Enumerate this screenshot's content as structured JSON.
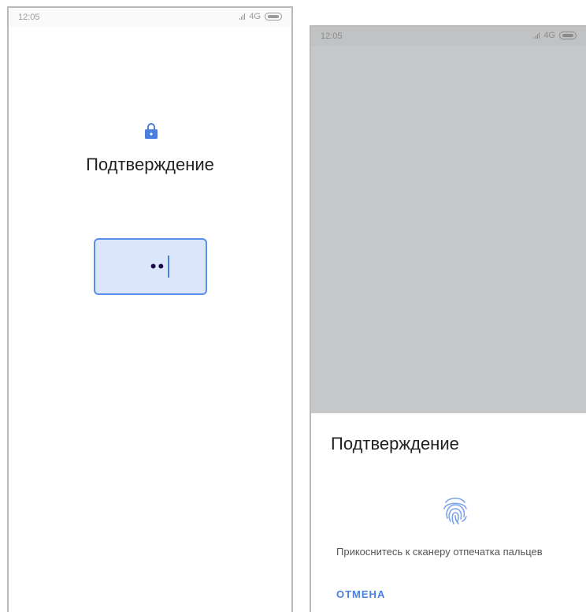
{
  "left_screen": {
    "status": {
      "time": "12:05",
      "network": "4G"
    },
    "title": "Подтверждение",
    "pin_field": {
      "masked_value": "••"
    }
  },
  "right_screen": {
    "status": {
      "time": "12:05",
      "network": "4G"
    },
    "dialog": {
      "title": "Подтверждение",
      "hint": "Прикоснитесь к сканеру отпечатка пальцев",
      "cancel_label": "ОТМЕНА"
    }
  },
  "colors": {
    "accent": "#4a7fe0",
    "pin_field_bg": "#dbe6fb",
    "overlay": "#c6c7c9"
  },
  "icons": [
    "lock-icon",
    "fingerprint-icon",
    "signal-icon",
    "battery-icon"
  ]
}
